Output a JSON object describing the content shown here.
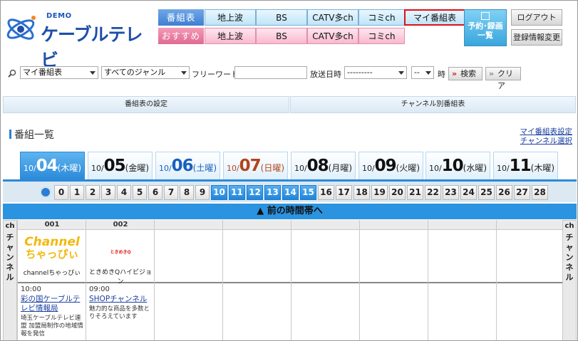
{
  "logo": {
    "demo": "DEMO",
    "name": "ケーブルテレビ"
  },
  "nav": {
    "row1_label": "番組表",
    "row2_label": "おすすめ",
    "row1": [
      "地上波",
      "BS",
      "CATV多ch",
      "コミch",
      "マイ番組表"
    ],
    "row2": [
      "地上波",
      "BS",
      "CATV多ch",
      "コミch"
    ],
    "reserve_line1": "予約･録画",
    "reserve_line2": "一覧",
    "logout": "ログアウト",
    "account": "登録情報変更"
  },
  "search": {
    "list_value": "マイ番組表",
    "genre_value": "すべてのジャンル",
    "freeword_label": "フリーワード",
    "freeword_value": "",
    "datetime_label": "放送日時",
    "date_value": "---------",
    "hour_value": "--",
    "hour_suffix": "時",
    "search_btn": "検索",
    "clear_btn": "クリア"
  },
  "settings": {
    "left": "番組表の設定",
    "right": "チャンネル別番組表"
  },
  "section": {
    "title": "番組一覧",
    "link1": "マイ番組表設定",
    "link2": "チャンネル選択"
  },
  "days": [
    {
      "m": "10/",
      "d": "04",
      "w": "(木曜)",
      "color": "#ffffff",
      "active": true
    },
    {
      "m": "10/",
      "d": "05",
      "w": "(金曜)",
      "color": "#111111",
      "active": false
    },
    {
      "m": "10/",
      "d": "06",
      "w": "(土曜)",
      "color": "#1a5fc0",
      "active": false
    },
    {
      "m": "10/",
      "d": "07",
      "w": "(日曜)",
      "color": "#b3451b",
      "active": false
    },
    {
      "m": "10/",
      "d": "08",
      "w": "(月曜)",
      "color": "#111111",
      "active": false
    },
    {
      "m": "10/",
      "d": "09",
      "w": "(火曜)",
      "color": "#111111",
      "active": false
    },
    {
      "m": "10/",
      "d": "10",
      "w": "(水曜)",
      "color": "#111111",
      "active": false
    },
    {
      "m": "10/",
      "d": "11",
      "w": "(木曜)",
      "color": "#111111",
      "active": false
    }
  ],
  "hours": [
    "0",
    "1",
    "2",
    "3",
    "4",
    "5",
    "6",
    "7",
    "8",
    "9",
    "10",
    "11",
    "12",
    "13",
    "14",
    "15",
    "16",
    "17",
    "18",
    "19",
    "20",
    "21",
    "22",
    "23",
    "24",
    "25",
    "26",
    "27",
    "28"
  ],
  "highlight_hours": [
    "10",
    "11",
    "12",
    "13",
    "14",
    "15"
  ],
  "prev_band": "▲ 前の時間帯へ",
  "side": {
    "head": "ch",
    "text": "チャンネル"
  },
  "channels": [
    {
      "no": "001",
      "logo_line1": "Channel",
      "logo_line2": "ちゃっぴぃ",
      "name": "channelちゃっぴぃ",
      "time": "10:00",
      "title": "彩の国ケーブルテレビ情報局",
      "desc": "埼玉ケーブルテレビ連盟 加盟局制作の地域情報を発信"
    },
    {
      "no": "002",
      "logo_small": "ときめきQ",
      "name": "ときめきQハイビジョン",
      "time": "09:00",
      "title": "SHOPチャンネル",
      "desc": "魅力的な商品を多数とりそろえています"
    }
  ],
  "colors": {
    "accent": "#2b8ad9",
    "tab_active": "#2b8ad9",
    "highlight_border": "#e0101a"
  }
}
